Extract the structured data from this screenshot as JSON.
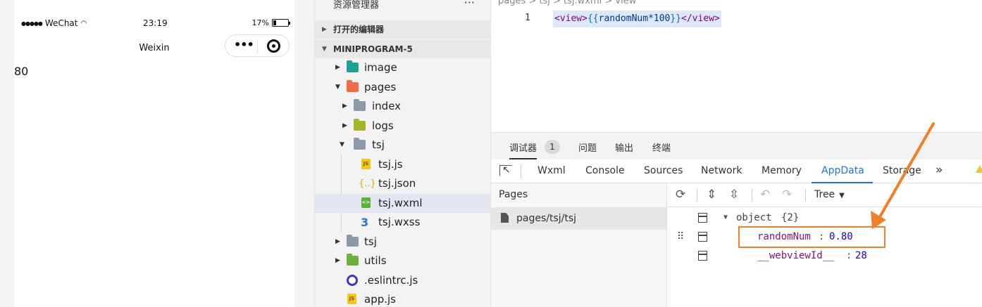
{
  "simulator": {
    "carrier": "WeChat",
    "time": "23:19",
    "battery": "17%",
    "nav_title": "Weixin",
    "page_value": "80"
  },
  "explorer": {
    "title": "资源管理器",
    "more": "···",
    "open_editors_label": "打开的编辑器",
    "project_label": "MINIPROGRAM-5",
    "items": [
      {
        "label": "image"
      },
      {
        "label": "pages"
      },
      {
        "label": "index"
      },
      {
        "label": "logs"
      },
      {
        "label": "tsj"
      },
      {
        "label": "tsj.js"
      },
      {
        "label": "tsj.json"
      },
      {
        "label": "tsj.wxml"
      },
      {
        "label": "tsj.wxss"
      },
      {
        "label": "tsj"
      },
      {
        "label": "utils"
      },
      {
        "label": ".eslintrc.js"
      },
      {
        "label": "app.js"
      }
    ]
  },
  "editor": {
    "breadcrumb": "pages > tsj > tsj.wxml > view",
    "line_number": "1",
    "code": {
      "open_tag": "<view>",
      "open_brace": "{{",
      "expression": "randomNum*100",
      "close_brace": "}}",
      "close_tag": "</view>"
    }
  },
  "devtools": {
    "top_tabs": [
      {
        "label": "调试器"
      },
      {
        "label": "问题"
      },
      {
        "label": "输出"
      },
      {
        "label": "终端"
      }
    ],
    "badge_count": "1",
    "panel_tabs": [
      {
        "label": "Wxml"
      },
      {
        "label": "Console"
      },
      {
        "label": "Sources"
      },
      {
        "label": "Network"
      },
      {
        "label": "Memory"
      },
      {
        "label": "AppData"
      },
      {
        "label": "Storage"
      }
    ],
    "overflow": "»",
    "pages_header": "Pages",
    "page_path": "pages/tsj/tsj",
    "tree_mode": "Tree",
    "data_tree": {
      "root_label": "object",
      "root_count": "{2}",
      "entries": [
        {
          "key": "randomNum",
          "value": "0.80"
        },
        {
          "key": "__webviewId__",
          "value": "28"
        }
      ]
    }
  },
  "colors": {
    "accent_blue": "#1a73e8",
    "annotation_orange": "#f07f2a"
  }
}
